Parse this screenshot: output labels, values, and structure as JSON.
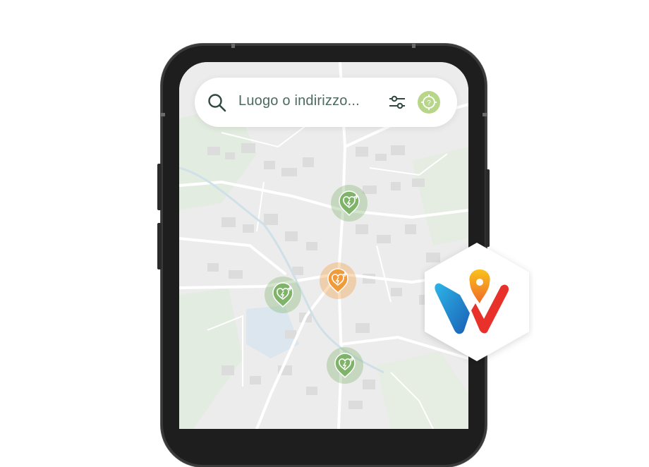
{
  "search": {
    "placeholder": "Luogo o indirizzo..."
  },
  "icons": {
    "search": "search-icon",
    "filter": "sliders-icon",
    "locate": "location-target-icon",
    "marker": "heart-defibrillator-icon",
    "logo": "twint-logo"
  },
  "markers": [
    {
      "status": "available",
      "color": "#7fb36a"
    },
    {
      "status": "selected",
      "color": "#f19a3a"
    },
    {
      "status": "available",
      "color": "#7fb36a"
    },
    {
      "status": "available",
      "color": "#7fb36a"
    }
  ],
  "colors": {
    "accent_green": "#7fb36a",
    "accent_orange": "#f19a3a",
    "searchbar_bg": "#ffffff",
    "map_bg": "#ececec"
  }
}
